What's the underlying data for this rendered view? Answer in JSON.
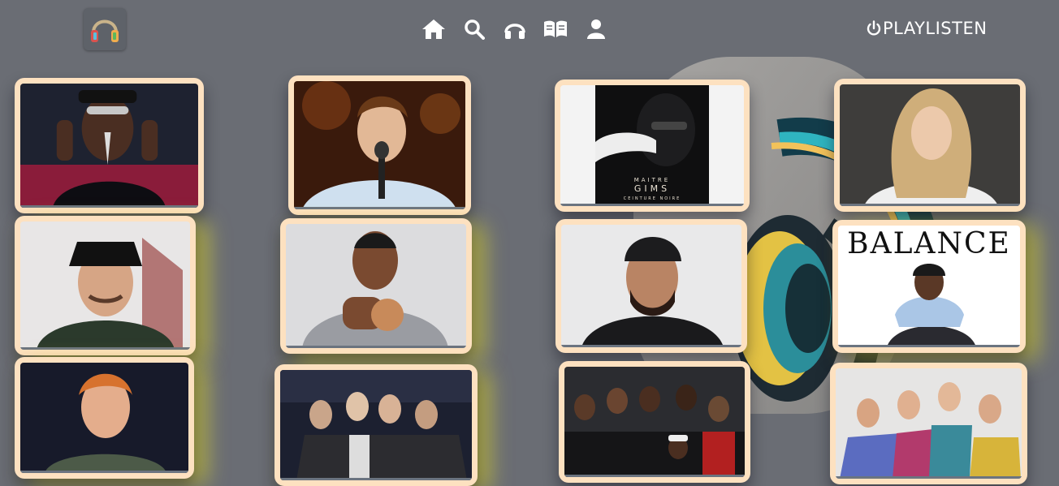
{
  "header": {
    "brand": "PLAYLISTEN",
    "nav": [
      {
        "icon": "home-icon"
      },
      {
        "icon": "search-icon"
      },
      {
        "icon": "headphones-icon"
      },
      {
        "icon": "book-icon"
      },
      {
        "icon": "user-icon"
      }
    ]
  },
  "cards": {
    "balance_title": "BALANCE",
    "gims_artist": "MAITRE",
    "gims_title": "GIMS",
    "gims_sub": "CEINTURE NOIRE"
  },
  "colors": {
    "background": "#6a6d74",
    "card_frame": "#fde1c0",
    "glow": "#ebe128"
  }
}
